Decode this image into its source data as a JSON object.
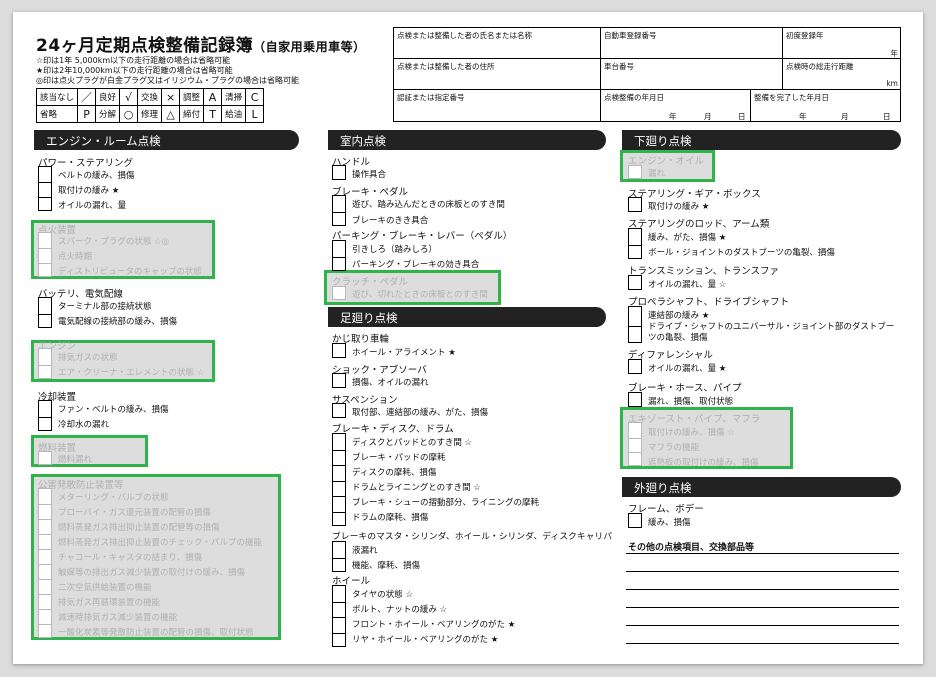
{
  "title": {
    "main": "24ヶ月定期点検整備記録簿",
    "sub": "（自家用乗用車等）"
  },
  "notes": [
    "☆印は1年  5,000km以下の走行距離の場合は省略可能",
    "★印は2年10,000km以下の走行距離の場合は省略可能",
    "◎印は点火プラグが白金プラグ又はイリジウム・プラグの場合は省略可能"
  ],
  "legend": [
    [
      "該当なし",
      "／",
      "良好",
      "√",
      "交換",
      "×",
      "調整",
      "A",
      "清掃",
      "C"
    ],
    [
      "省略",
      "P",
      "分解",
      "○",
      "修理",
      "△",
      "締付",
      "T",
      "給油",
      "L"
    ]
  ],
  "info": {
    "owner_name": "点検または整備した者の氏名または名称",
    "reg_no": "自動車登録番号",
    "first_reg": "初度登録年",
    "nen": "年",
    "owner_addr": "点検または整備した者の住所",
    "chassis_no": "車台番号",
    "odometer": "点検時の総走行距離",
    "km": "km",
    "cert_no": "認証または指定番号",
    "inspect_date": "点検整備の年月日",
    "complete_date": "整備を完了した年月日",
    "y": "年",
    "m": "月",
    "d": "日"
  },
  "sections": {
    "engine_room": "エンジン・ルーム点検",
    "cabin": "室内点検",
    "under": "下廻り点検",
    "running": "足廻り点検",
    "exterior": "外廻り点検"
  },
  "engine_room": {
    "power_steering": {
      "title": "パワー・ステアリング",
      "items": [
        "ベルトの緩み、損傷",
        "取付けの緩み ★",
        "オイルの漏れ、量"
      ]
    },
    "ignition": {
      "title": "点火装置",
      "items": [
        "スパーク・プラグの状態  ☆◎",
        "点火時期",
        "ディストリビュータのキャップの状態"
      ]
    },
    "battery": {
      "title": "バッテリ、電気配線",
      "items": [
        "ターミナル部の接続状態",
        "電気配線の接続部の緩み、損傷"
      ]
    },
    "engine": {
      "title": "エンジン",
      "items": [
        "排気ガスの状態",
        "エア・クリーナ・エレメントの状態  ☆"
      ]
    },
    "cooling": {
      "title": "冷却装置",
      "items": [
        "ファン・ベルトの緩み、損傷",
        "冷却水の漏れ"
      ]
    },
    "fuel": {
      "title": "燃料装置",
      "items": [
        "燃料漏れ"
      ]
    },
    "emission": {
      "title": "公害発散防止装置等",
      "items": [
        "メターリング・バルブの状態",
        "ブローバイ・ガス還元装置の配管の損傷",
        "燃料蒸発ガス排出抑止装置の配管等の損傷",
        "燃料蒸発ガス排出抑止装置のチェック・バルブの機能",
        "チャコール・キャスタの詰まり、損傷",
        "触媒等の排出ガス減少装置の取付けの緩み、損傷",
        "二次空気供給装置の機能",
        "排気ガス再循環装置の機能",
        "減速時排気ガス減少装置の機能",
        "一酸化炭素等発散防止装置の配管の損傷、取付状態"
      ]
    }
  },
  "cabin": {
    "handle": {
      "title": "ハンドル",
      "items": [
        "操作具合"
      ]
    },
    "brake_pedal": {
      "title": "ブレーキ・ペダル",
      "items": [
        "遊び、踏み込んだときの床板とのすき間",
        "ブレーキのきき具合"
      ]
    },
    "parking": {
      "title": "パーキング・ブレーキ・レバー（ペダル）",
      "items": [
        "引きしろ（踏みしろ）",
        "パーキング・ブレーキの効き具合"
      ]
    },
    "clutch": {
      "title": "クラッチ・ペダル",
      "items": [
        "遊び、切れたときの床板とのすき間"
      ]
    }
  },
  "running": {
    "steering": {
      "title": "かじ取り車輪",
      "items": [
        "ホイール・アライメント ★"
      ]
    },
    "shock": {
      "title": "ショック・アブソーバ",
      "items": [
        "損傷、オイルの漏れ"
      ]
    },
    "suspension": {
      "title": "サスペンション",
      "items": [
        "取付部、連結部の緩み、がた、損傷"
      ]
    },
    "brake_disc": {
      "title": "ブレーキ・ディスク、ドラム",
      "items": [
        "ディスクとパッドとのすき間 ☆",
        "ブレーキ・パッドの摩耗",
        "ディスクの摩耗、損傷",
        "ドラムとライニングとのすき間 ☆",
        "ブレーキ・シューの摺動部分、ライニングの摩耗",
        "ドラムの摩耗、損傷"
      ]
    },
    "master": {
      "title": "ブレーキのマスタ・シリンダ、ホイール・シリンダ、ディスクキャリパ",
      "items": [
        "液漏れ",
        "機能、摩耗、損傷"
      ]
    },
    "wheel": {
      "title": "ホイール",
      "items": [
        "タイヤの状態 ☆",
        "ボルト、ナットの緩み ☆",
        "フロント・ホイール・ベアリングのがた ★",
        "リヤ・ホイール・ベアリングのがた ★"
      ]
    }
  },
  "under": {
    "engine_oil": {
      "title": "エンジン・オイル",
      "items": [
        "漏れ"
      ]
    },
    "gearbox": {
      "title": "ステアリング・ギア・ボックス",
      "items": [
        "取付けの緩み ★"
      ]
    },
    "rod": {
      "title": "ステアリングのロッド、アーム類",
      "items": [
        "緩み、がた、損傷 ★",
        "ボール・ジョイントのダストブーツの亀裂、損傷"
      ]
    },
    "transmission": {
      "title": "トランスミッション、トランスファ",
      "items": [
        "オイルの漏れ、量 ☆"
      ]
    },
    "propeller": {
      "title": "プロペラシャフト、ドライブシャフト",
      "items": [
        "連結部の緩み ★",
        "ドライブ・シャフトのユニバーサル・ジョイント部のダストブーツの亀裂、損傷"
      ]
    },
    "differential": {
      "title": "ディファレンシャル",
      "items": [
        "オイルの漏れ、量 ★"
      ]
    },
    "brake_hose": {
      "title": "ブレーキ・ホース、パイプ",
      "items": [
        "漏れ、損傷、取付状態"
      ]
    },
    "exhaust": {
      "title": "エキゾースト・パイプ、マフラ",
      "items": [
        "取付けの緩み、損傷 ☆",
        "マフラの機能",
        "遮熱板の取付けの緩み、損傷"
      ]
    }
  },
  "exterior": {
    "frame": {
      "title": "フレーム、ボデー",
      "items": [
        "緩み、損傷"
      ]
    },
    "other": "その他の点検項目、交換部品等"
  }
}
